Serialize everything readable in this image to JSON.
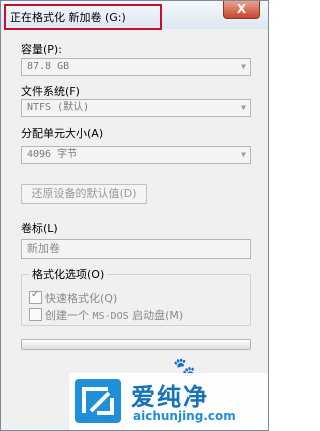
{
  "window": {
    "title": "正在格式化 新加卷 (G:)",
    "close_label": "X"
  },
  "capacity": {
    "label": "容量(P):",
    "value": "87.8 GB"
  },
  "filesystem": {
    "label": "文件系统(F)",
    "value": "NTFS (默认)"
  },
  "allocation": {
    "label": "分配单元大小(A)",
    "value": "4096 字节"
  },
  "restore_button": {
    "label": "还原设备的默认值(D)"
  },
  "volume_label": {
    "label": "卷标(L)",
    "value": "新加卷"
  },
  "format_options": {
    "title": "格式化选项(O)",
    "quick_format": {
      "label": "快速格式化(Q)",
      "checked": true
    },
    "msdos_disk": {
      "label_prefix": "创建一个",
      "label_mono": "MS-DOS",
      "label_suffix": "启动盘(M)",
      "checked": false
    }
  },
  "progress": {
    "fraction": 0
  },
  "watermark": {
    "name": "爱纯净",
    "url": "aichunjing.com",
    "brand_color": "#1f90d8"
  }
}
